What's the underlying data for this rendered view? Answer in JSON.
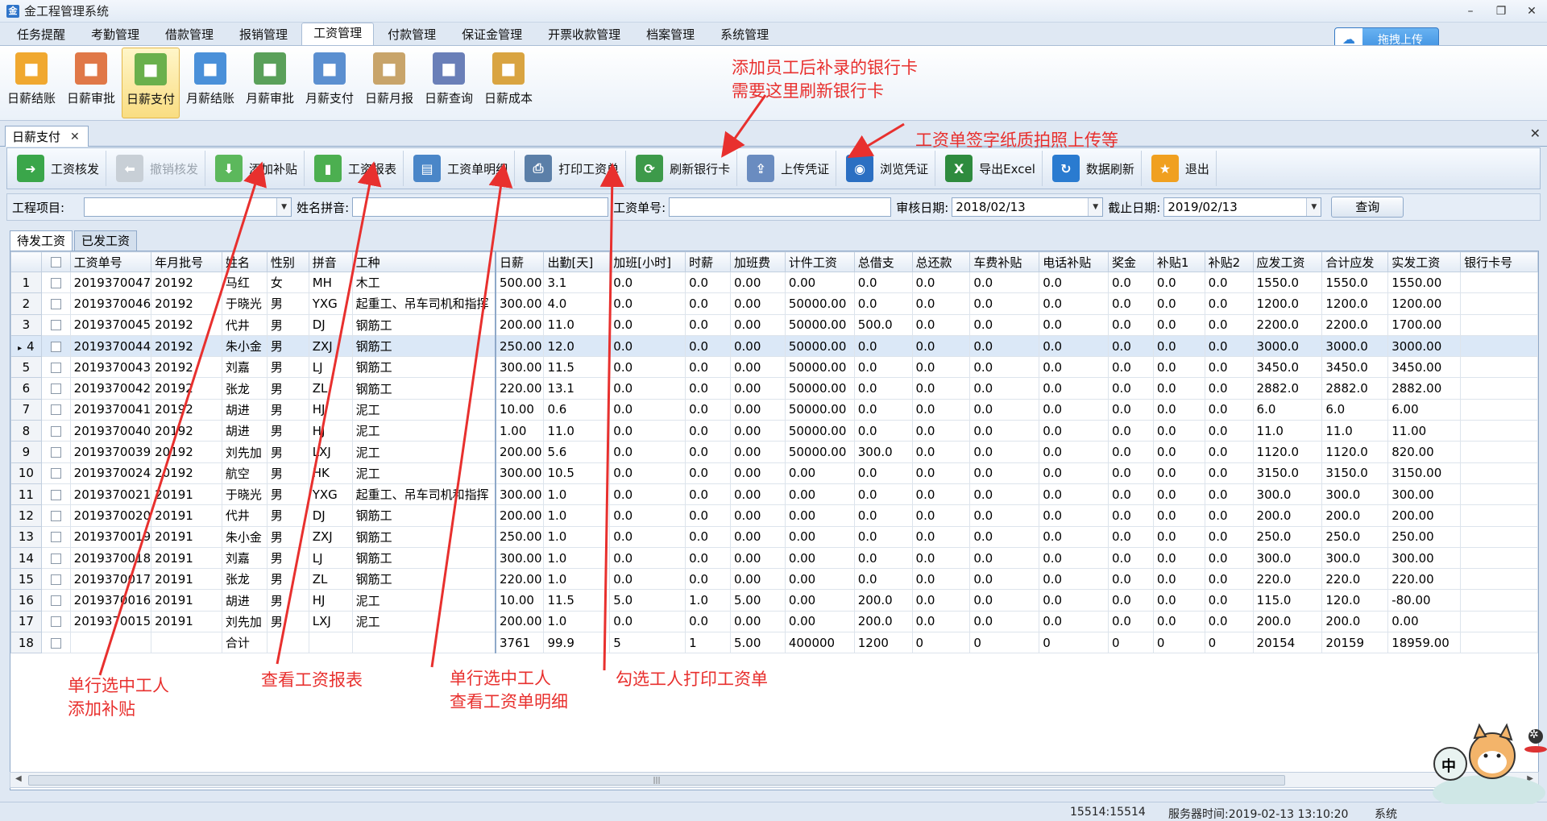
{
  "window": {
    "title": "金工程管理系统",
    "controls": [
      "–",
      "❐",
      "✕"
    ]
  },
  "menu_tabs": [
    {
      "label": "任务提醒"
    },
    {
      "label": "考勤管理"
    },
    {
      "label": "借款管理"
    },
    {
      "label": "报销管理"
    },
    {
      "label": "工资管理",
      "active": true
    },
    {
      "label": "付款管理"
    },
    {
      "label": "保证金管理"
    },
    {
      "label": "开票收款管理"
    },
    {
      "label": "档案管理"
    },
    {
      "label": "系统管理"
    }
  ],
  "upload_button": {
    "icon": "cloud-icon",
    "label": "拖拽上传"
  },
  "ribbon": [
    {
      "label": "日薪结账",
      "icon": "calendar-icon",
      "color": "#f0a830"
    },
    {
      "label": "日薪审批",
      "icon": "user-approve-icon",
      "color": "#e07848"
    },
    {
      "label": "日薪支付",
      "icon": "users-pay-icon",
      "color": "#6ab04c",
      "active": true
    },
    {
      "label": "月薪结账",
      "icon": "clock-icon",
      "color": "#4a90d9"
    },
    {
      "label": "月薪审批",
      "icon": "document-approve-icon",
      "color": "#5aa05a"
    },
    {
      "label": "月薪支付",
      "icon": "card-icon",
      "color": "#5b8fd0"
    },
    {
      "label": "日薪月报",
      "icon": "box-report-icon",
      "color": "#c8a46a"
    },
    {
      "label": "日薪查询",
      "icon": "building-query-icon",
      "color": "#6a7fb8"
    },
    {
      "label": "日薪成本",
      "icon": "hand-coins-icon",
      "color": "#d9a441"
    }
  ],
  "doc_tab": {
    "label": "日薪支付",
    "close": "✕"
  },
  "strip_close": "✕",
  "toolbar": [
    {
      "label": "工资核发",
      "icon": "arrow-right-icon",
      "color": "#3aa64a"
    },
    {
      "label": "撤销核发",
      "icon": "arrow-left-icon",
      "color": "#9aa3ad",
      "disabled": true
    },
    {
      "label": "添加补贴",
      "icon": "arrow-down-icon",
      "color": "#5cb85c"
    },
    {
      "label": "工资报表",
      "icon": "bar-chart-icon",
      "color": "#4caf50"
    },
    {
      "label": "工资单明细",
      "icon": "detail-sheet-icon",
      "color": "#4a86c8"
    },
    {
      "label": "打印工资单",
      "icon": "printer-icon",
      "color": "#5b7fa8"
    },
    {
      "label": "刷新银行卡",
      "icon": "refresh-card-icon",
      "color": "#3d9a4a"
    },
    {
      "label": "上传凭证",
      "icon": "upload-doc-icon",
      "color": "#6a8cc0"
    },
    {
      "label": "浏览凭证",
      "icon": "browse-icon",
      "color": "#2b6fc2"
    },
    {
      "label": "导出Excel",
      "icon": "excel-icon",
      "color": "#2e8b3e"
    },
    {
      "label": "数据刷新",
      "icon": "sync-icon",
      "color": "#2a7bd0"
    },
    {
      "label": "退出",
      "icon": "exit-icon",
      "color": "#f0a020"
    }
  ],
  "filters": {
    "project_label": "工程项目:",
    "project_value": "",
    "pinyin_label": "姓名拼音:",
    "pinyin_value": "",
    "slip_label": "工资单号:",
    "slip_value": "",
    "audit_label": "审核日期:",
    "audit_value": "2018/02/13",
    "end_label": "截止日期:",
    "end_value": "2019/02/13",
    "query_label": "查询"
  },
  "sub_tabs": [
    {
      "label": "待发工资",
      "active": true
    },
    {
      "label": "已发工资"
    }
  ],
  "grid": {
    "columns": [
      "",
      "",
      "工资单号",
      "年月批号",
      "姓名",
      "性别",
      "拼音",
      "工种",
      "日薪",
      "出勤[天]",
      "加班[小时]",
      "时薪",
      "加班费",
      "计件工资",
      "总借支",
      "总还款",
      "车费补贴",
      "电话补贴",
      "奖金",
      "补贴1",
      "补贴2",
      "应发工资",
      "合计应发",
      "实发工资",
      "银行卡号"
    ],
    "rows": [
      [
        "1",
        "2019370047",
        "20192",
        "马红",
        "女",
        "MH",
        "木工",
        "500.00",
        "3.1",
        "0.0",
        "0.0",
        "0.00",
        "0.00",
        "0.0",
        "0.0",
        "0.0",
        "0.0",
        "0.0",
        "0.0",
        "0.0",
        "1550.0",
        "1550.0",
        "1550.00",
        ""
      ],
      [
        "2",
        "2019370046",
        "20192",
        "于晓光",
        "男",
        "YXG",
        "起重工、吊车司机和指挥",
        "300.00",
        "4.0",
        "0.0",
        "0.0",
        "0.00",
        "50000.00",
        "0.0",
        "0.0",
        "0.0",
        "0.0",
        "0.0",
        "0.0",
        "0.0",
        "1200.0",
        "1200.0",
        "1200.00",
        ""
      ],
      [
        "3",
        "2019370045",
        "20192",
        "代井",
        "男",
        "DJ",
        "钢筋工",
        "200.00",
        "11.0",
        "0.0",
        "0.0",
        "0.00",
        "50000.00",
        "500.0",
        "0.0",
        "0.0",
        "0.0",
        "0.0",
        "0.0",
        "0.0",
        "2200.0",
        "2200.0",
        "1700.00",
        ""
      ],
      [
        "4",
        "2019370044",
        "20192",
        "朱小金",
        "男",
        "ZXJ",
        "钢筋工",
        "250.00",
        "12.0",
        "0.0",
        "0.0",
        "0.00",
        "50000.00",
        "0.0",
        "0.0",
        "0.0",
        "0.0",
        "0.0",
        "0.0",
        "0.0",
        "3000.0",
        "3000.0",
        "3000.00",
        ""
      ],
      [
        "5",
        "2019370043",
        "20192",
        "刘嘉",
        "男",
        "LJ",
        "钢筋工",
        "300.00",
        "11.5",
        "0.0",
        "0.0",
        "0.00",
        "50000.00",
        "0.0",
        "0.0",
        "0.0",
        "0.0",
        "0.0",
        "0.0",
        "0.0",
        "3450.0",
        "3450.0",
        "3450.00",
        ""
      ],
      [
        "6",
        "2019370042",
        "20192",
        "张龙",
        "男",
        "ZL",
        "钢筋工",
        "220.00",
        "13.1",
        "0.0",
        "0.0",
        "0.00",
        "50000.00",
        "0.0",
        "0.0",
        "0.0",
        "0.0",
        "0.0",
        "0.0",
        "0.0",
        "2882.0",
        "2882.0",
        "2882.00",
        ""
      ],
      [
        "7",
        "2019370041",
        "20192",
        "胡进",
        "男",
        "HJ",
        "泥工",
        "10.00",
        "0.6",
        "0.0",
        "0.0",
        "0.00",
        "50000.00",
        "0.0",
        "0.0",
        "0.0",
        "0.0",
        "0.0",
        "0.0",
        "0.0",
        "6.0",
        "6.0",
        "6.00",
        ""
      ],
      [
        "8",
        "2019370040",
        "20192",
        "胡进",
        "男",
        "HJ",
        "泥工",
        "1.00",
        "11.0",
        "0.0",
        "0.0",
        "0.00",
        "50000.00",
        "0.0",
        "0.0",
        "0.0",
        "0.0",
        "0.0",
        "0.0",
        "0.0",
        "11.0",
        "11.0",
        "11.00",
        ""
      ],
      [
        "9",
        "2019370039",
        "20192",
        "刘先加",
        "男",
        "LXJ",
        "泥工",
        "200.00",
        "5.6",
        "0.0",
        "0.0",
        "0.00",
        "50000.00",
        "300.0",
        "0.0",
        "0.0",
        "0.0",
        "0.0",
        "0.0",
        "0.0",
        "1120.0",
        "1120.0",
        "820.00",
        ""
      ],
      [
        "10",
        "2019370024",
        "20192",
        "航空",
        "男",
        "HK",
        "泥工",
        "300.00",
        "10.5",
        "0.0",
        "0.0",
        "0.00",
        "0.00",
        "0.0",
        "0.0",
        "0.0",
        "0.0",
        "0.0",
        "0.0",
        "0.0",
        "3150.0",
        "3150.0",
        "3150.00",
        ""
      ],
      [
        "11",
        "2019370021",
        "20191",
        "于晓光",
        "男",
        "YXG",
        "起重工、吊车司机和指挥",
        "300.00",
        "1.0",
        "0.0",
        "0.0",
        "0.00",
        "0.00",
        "0.0",
        "0.0",
        "0.0",
        "0.0",
        "0.0",
        "0.0",
        "0.0",
        "300.0",
        "300.0",
        "300.00",
        ""
      ],
      [
        "12",
        "2019370020",
        "20191",
        "代井",
        "男",
        "DJ",
        "钢筋工",
        "200.00",
        "1.0",
        "0.0",
        "0.0",
        "0.00",
        "0.00",
        "0.0",
        "0.0",
        "0.0",
        "0.0",
        "0.0",
        "0.0",
        "0.0",
        "200.0",
        "200.0",
        "200.00",
        ""
      ],
      [
        "13",
        "2019370019",
        "20191",
        "朱小金",
        "男",
        "ZXJ",
        "钢筋工",
        "250.00",
        "1.0",
        "0.0",
        "0.0",
        "0.00",
        "0.00",
        "0.0",
        "0.0",
        "0.0",
        "0.0",
        "0.0",
        "0.0",
        "0.0",
        "250.0",
        "250.0",
        "250.00",
        ""
      ],
      [
        "14",
        "2019370018",
        "20191",
        "刘嘉",
        "男",
        "LJ",
        "钢筋工",
        "300.00",
        "1.0",
        "0.0",
        "0.0",
        "0.00",
        "0.00",
        "0.0",
        "0.0",
        "0.0",
        "0.0",
        "0.0",
        "0.0",
        "0.0",
        "300.0",
        "300.0",
        "300.00",
        ""
      ],
      [
        "15",
        "2019370017",
        "20191",
        "张龙",
        "男",
        "ZL",
        "钢筋工",
        "220.00",
        "1.0",
        "0.0",
        "0.0",
        "0.00",
        "0.00",
        "0.0",
        "0.0",
        "0.0",
        "0.0",
        "0.0",
        "0.0",
        "0.0",
        "220.0",
        "220.0",
        "220.00",
        ""
      ],
      [
        "16",
        "2019370016",
        "20191",
        "胡进",
        "男",
        "HJ",
        "泥工",
        "10.00",
        "11.5",
        "5.0",
        "1.0",
        "5.00",
        "0.00",
        "200.0",
        "0.0",
        "0.0",
        "0.0",
        "0.0",
        "0.0",
        "0.0",
        "115.0",
        "120.0",
        "-80.00",
        ""
      ],
      [
        "17",
        "2019370015",
        "20191",
        "刘先加",
        "男",
        "LXJ",
        "泥工",
        "200.00",
        "1.0",
        "0.0",
        "0.0",
        "0.00",
        "0.00",
        "200.0",
        "0.0",
        "0.0",
        "0.0",
        "0.0",
        "0.0",
        "0.0",
        "200.0",
        "200.0",
        "0.00",
        ""
      ],
      [
        "18",
        "",
        "",
        "合计",
        "",
        "",
        "",
        "3761",
        "99.9",
        "5",
        "1",
        "5.00",
        "400000",
        "1200",
        "0",
        "0",
        "0",
        "0",
        "0",
        "0",
        "20154",
        "20159",
        "18959.00",
        ""
      ]
    ],
    "selected_row": 4,
    "row_marker": "▸"
  },
  "status": {
    "counts": "15514:15514",
    "server_time": "服务器时间:2019-02-13 13:10:20",
    "system": "系统"
  },
  "annotations": {
    "bank_card_1": "添加员工后补录的银行卡",
    "bank_card_2": "需要这里刷新银行卡",
    "upload": "工资单签字纸质拍照上传等",
    "subsidy_1": "单行选中工人",
    "subsidy_2": "添加补贴",
    "report": "查看工资报表",
    "detail_1": "单行选中工人",
    "detail_2": "查看工资单明细",
    "print": "勾选工人打印工资单"
  },
  "mascot": {
    "badge": "中",
    "icon": "gear-icon"
  },
  "colors": {
    "annotation": "#e8302e",
    "accent": "#3d8fe0",
    "active_ribbon": "#f9dd82"
  }
}
